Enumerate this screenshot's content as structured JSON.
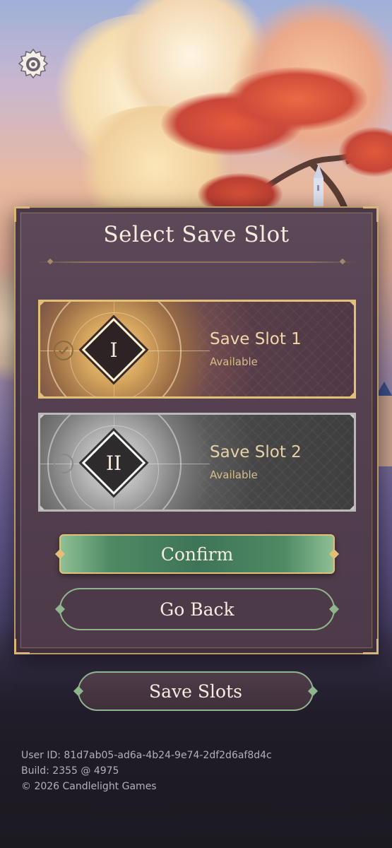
{
  "dialog": {
    "title": "Select Save Slot"
  },
  "slots": [
    {
      "numeral": "I",
      "name": "Save Slot 1",
      "status": "Available",
      "selected": true,
      "accent": "#e2c078"
    },
    {
      "numeral": "II",
      "name": "Save Slot 2",
      "status": "Available",
      "selected": false,
      "accent": "#b9b9b9"
    }
  ],
  "actions": {
    "confirm_label": "Confirm",
    "back_label": "Go Back",
    "save_slots_label": "Save Slots"
  },
  "footer": {
    "user_id": "User ID: 81d7ab05-ad6a-4b24-9e74-2df2d6af8d4c",
    "build": "Build: 2355 @ 4975",
    "copyright": "© 2026 Candlelight Games"
  },
  "icons": {
    "settings": "gear-icon",
    "selected": "check-icon"
  },
  "colors": {
    "gold_accent": "#e2c078",
    "green_accent": "#8fb58d",
    "panel": "#55414f"
  }
}
